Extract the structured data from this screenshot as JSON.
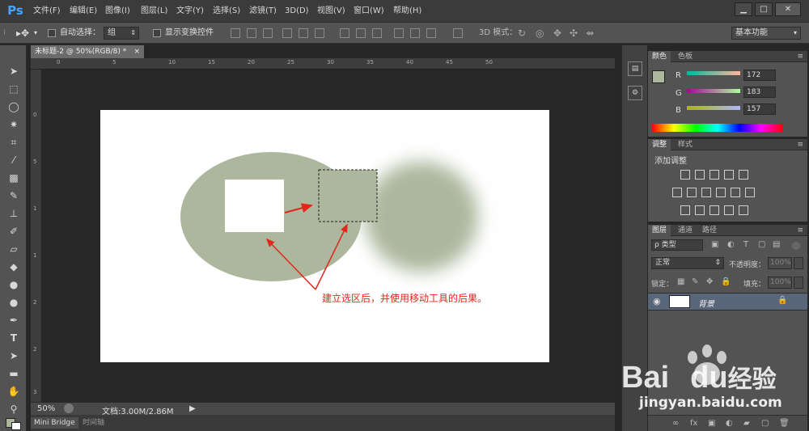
{
  "app": {
    "logo": "Ps"
  },
  "menu": [
    {
      "label": "文件(F)"
    },
    {
      "label": "编辑(E)"
    },
    {
      "label": "图像(I)"
    },
    {
      "label": "图层(L)"
    },
    {
      "label": "文字(Y)"
    },
    {
      "label": "选择(S)"
    },
    {
      "label": "滤镜(T)"
    },
    {
      "label": "3D(D)"
    },
    {
      "label": "视图(V)"
    },
    {
      "label": "窗口(W)"
    },
    {
      "label": "帮助(H)"
    }
  ],
  "window_controls": {
    "minimize": "▁",
    "maximize": "□",
    "close": "✕"
  },
  "options": {
    "auto_select_label": "自动选择：",
    "auto_select_value": "组",
    "show_transform_label": "显示变换控件",
    "mode_3d_label": "3D 模式：",
    "workspace": "基本功能"
  },
  "document": {
    "tab_title": "未标题-2 @ 50%(RGB/8) *",
    "tab_close": "×",
    "ruler_h": [
      "0",
      "5",
      "10",
      "15",
      "20",
      "25",
      "30",
      "35",
      "40",
      "45",
      "50"
    ],
    "ruler_v": [
      "0",
      "5",
      "1",
      "1",
      "2",
      "2",
      "3"
    ],
    "annotation": "建立选区后，并使用移动工具的后果。"
  },
  "status": {
    "zoom": "50%",
    "doc": "文档:3.00M/2.86M",
    "arrow": "▶"
  },
  "bottom_tabs": {
    "mini_bridge": "Mini Bridge",
    "timeline": "时间轴"
  },
  "color_panel": {
    "tab_color": "颜色",
    "tab_swatches": "色板",
    "r_label": "R",
    "g_label": "G",
    "b_label": "B",
    "r": "172",
    "g": "183",
    "b": "157",
    "fg": "#acb79d",
    "bg": "#ffffff"
  },
  "adjust_panel": {
    "tab_adjust": "调整",
    "tab_styles": "样式",
    "title": "添加调整"
  },
  "layers_panel": {
    "tab_layers": "图层",
    "tab_channels": "通道",
    "tab_paths": "路径",
    "filter_kind": "ρ 类型",
    "blend_mode": "正常",
    "opacity_label": "不透明度：",
    "opacity": "100%",
    "lock_label": "锁定：",
    "fill_label": "填充：",
    "fill": "100%",
    "layer_name": "背景"
  },
  "watermark": {
    "brand_part1": "Bai",
    "brand_part2": "du",
    "brand_cn": "经验",
    "url": "jingyan.baidu.com"
  },
  "colors": {
    "shape": "#acb79d",
    "accent_red": "#e3261c",
    "selected_layer": "#596579"
  }
}
